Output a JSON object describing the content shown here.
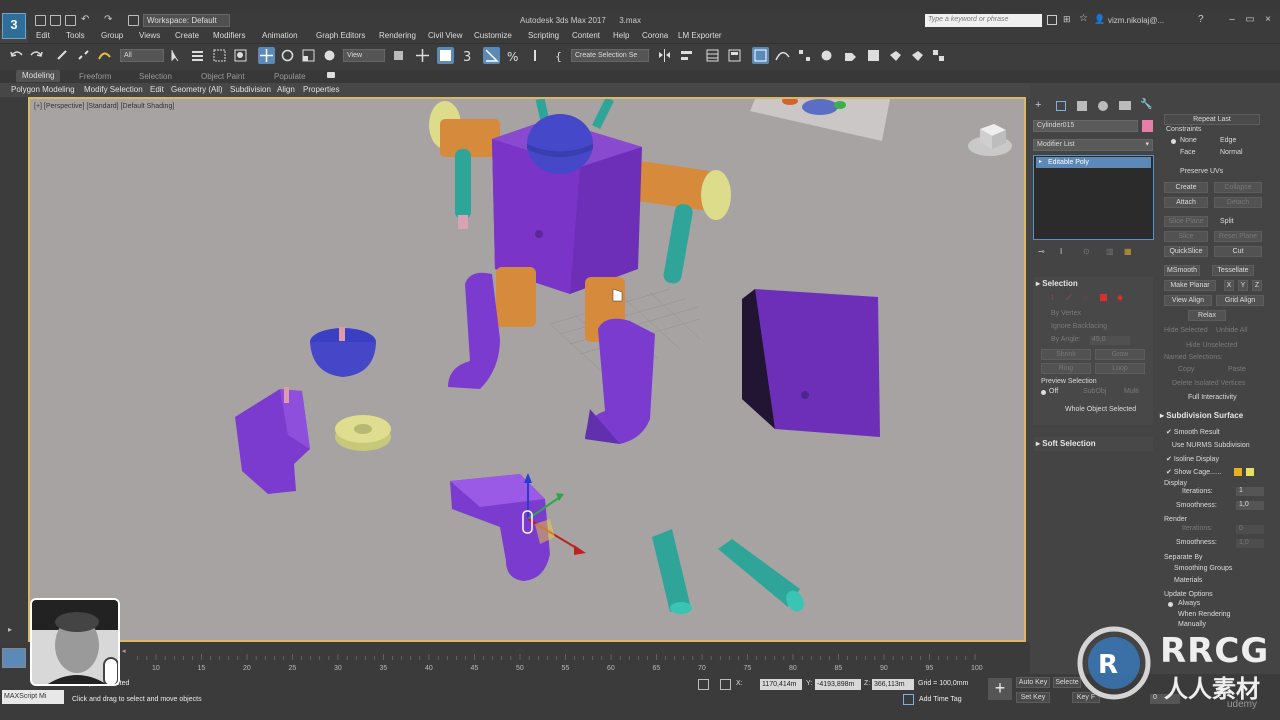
{
  "app": {
    "logo": "3",
    "logo_sub": "MAX",
    "title": "Autodesk 3ds Max 2017",
    "file": "3.max",
    "workspace": "Workspace: Default",
    "search_placeholder": "Type a keyword or phrase",
    "user": "vizm.nikolaj@..."
  },
  "menu": [
    "Edit",
    "Tools",
    "Group",
    "Views",
    "Create",
    "Modifiers",
    "Animation",
    "Graph Editors",
    "Rendering",
    "Civil View",
    "Customize",
    "Scripting",
    "Content",
    "Help",
    "Corona",
    "LM Exporter"
  ],
  "toolbar": {
    "filter": "All",
    "view": "View",
    "selection_set": "Create Selection Se"
  },
  "ribbon_tabs": [
    "Modeling",
    "Freeform",
    "Selection",
    "Object Paint",
    "Populate"
  ],
  "ribbon_items": [
    "Polygon Modeling",
    "Modify Selection",
    "Edit",
    "Geometry (All)",
    "Subdivision",
    "Align",
    "Properties"
  ],
  "viewport": {
    "label": "[+] [Perspective] [Standard] [Default Shading]"
  },
  "command_panel": {
    "object_name": "Cylinder015",
    "object_color": "#e87ea8",
    "modifier_list": "Modifier List",
    "stack_item": "Editable Poly",
    "selection": {
      "header": "Selection",
      "by_vertex": "By Vertex",
      "ignore_backfacing": "Ignore Backfacing",
      "by_angle": "By Angle:",
      "angle_value": "45,0",
      "shrink": "Shrink",
      "grow": "Grow",
      "ring": "Ring",
      "loop": "Loop",
      "preview_label": "Preview Selection",
      "off": "Off",
      "subobj": "SubObj",
      "multi": "Multi",
      "whole": "Whole Object Selected"
    },
    "soft_selection": "Soft Selection"
  },
  "edit_geometry": {
    "repeat_last": "Repeat Last",
    "constraints": "Constraints",
    "none": "None",
    "edge": "Edge",
    "face": "Face",
    "normal": "Normal",
    "preserve_uvs": "Preserve UVs",
    "create": "Create",
    "collapse": "Collapse",
    "attach": "Attach",
    "detach": "Detach",
    "slice_plane": "Slice Plane",
    "split": "Split",
    "slice": "Slice",
    "reset_plane": "Reset Plane",
    "quickslice": "QuickSlice",
    "cut": "Cut",
    "msmooth": "MSmooth",
    "tessellate": "Tessellate",
    "make_planar": "Make Planar",
    "x": "X",
    "y": "Y",
    "z": "Z",
    "view_align": "View Align",
    "grid_align": "Grid Align",
    "relax": "Relax",
    "hide_selected": "Hide Selected",
    "unhide_all": "Unhide All",
    "hide_unselected": "Hide Unselected",
    "named_selections": "Named Selections:",
    "copy": "Copy",
    "paste": "Paste",
    "delete_isolated": "Delete Isolated Vertices",
    "full_interactivity": "Full Interactivity"
  },
  "subdivision": {
    "header": "Subdivision Surface",
    "smooth_result": "Smooth Result",
    "use_nurms": "Use NURMS Subdivision",
    "isoline": "Isoline Display",
    "show_cage": "Show Cage......",
    "display": "Display",
    "iterations": "Iterations:",
    "iter_value": "1",
    "smoothness": "Smoothness:",
    "smooth_value": "1,0",
    "render": "Render",
    "r_iter_value": "0",
    "r_smooth_value": "1,0",
    "separate_by": "Separate By",
    "smoothing_groups": "Smoothing Groups",
    "materials": "Materials",
    "update_options": "Update Options",
    "always": "Always",
    "when_rendering": "When Rendering",
    "manually": "Manually"
  },
  "timeline": {
    "ticks": [
      "10",
      "15",
      "20",
      "25",
      "30",
      "35",
      "40",
      "45",
      "50",
      "55",
      "60",
      "65",
      "70",
      "75",
      "80",
      "85",
      "90",
      "95",
      "100"
    ]
  },
  "status": {
    "maxscript": "MAXScript Mi",
    "objects": "Object Selected",
    "prompt": "Click and drag to select and move objects",
    "x_label": "X:",
    "x_value": "1170,414m",
    "y_label": "Y:",
    "y_value": "-4193,898m",
    "z_label": "Z:",
    "z_value": "366,113m",
    "grid": "Grid = 100,0mm",
    "add_time_tag": "Add Time Tag",
    "auto_key": "Auto Key",
    "set_key": "Set Key",
    "selected": "Selecte",
    "key_filters": "Key F",
    "frame": "0"
  },
  "watermark": {
    "brand": "RRCG",
    "chinese": "人人素材",
    "udemy": "udemy"
  }
}
